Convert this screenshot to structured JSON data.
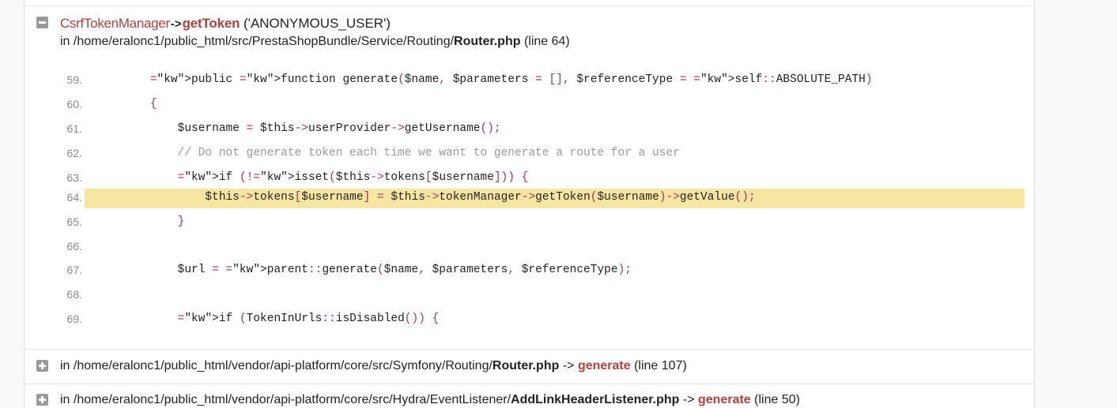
{
  "trace": {
    "class": "CsrfTokenManager",
    "arrow": "->",
    "method": "getToken",
    "args": "('ANONYMOUS_USER')",
    "path_prefix": "in /home/eralonc1/public_html/src/PrestaShopBundle/Service/Routing/",
    "file": "Router.php",
    "line_info": "(line 64)"
  },
  "code_lines": [
    {
      "num": "59.",
      "src": "    public function generate($name, $parameters = [], $referenceType = self::ABSOLUTE_PATH)"
    },
    {
      "num": "60.",
      "src": "    {"
    },
    {
      "num": "61.",
      "src": "        $username = $this->userProvider->getUsername();"
    },
    {
      "num": "62.",
      "src": "        // Do not generate token each time we want to generate a route for a user"
    },
    {
      "num": "63.",
      "src": "        if (!isset($this->tokens[$username])) {"
    },
    {
      "num": "64.",
      "src": "            $this->tokens[$username] = $this->tokenManager->getToken($username)->getValue();"
    },
    {
      "num": "65.",
      "src": "        }"
    },
    {
      "num": "66.",
      "src": ""
    },
    {
      "num": "67.",
      "src": "        $url = parent::generate($name, $parameters, $referenceType);"
    },
    {
      "num": "68.",
      "src": ""
    },
    {
      "num": "69.",
      "src": "        if (TokenInUrls::isDisabled()) {"
    }
  ],
  "frames": [
    {
      "path_prefix": "in /home/eralonc1/public_html/vendor/api-platform/core/src/Symfony/Routing/",
      "file": "Router.php",
      "arrow": "->",
      "method": "generate",
      "line_info": "(line 107)"
    },
    {
      "path_prefix": "in /home/eralonc1/public_html/vendor/api-platform/core/src/Hydra/EventListener/",
      "file": "AddLinkHeaderListener.php",
      "arrow": "->",
      "method": "generate",
      "line_info": "(line 50)"
    }
  ]
}
